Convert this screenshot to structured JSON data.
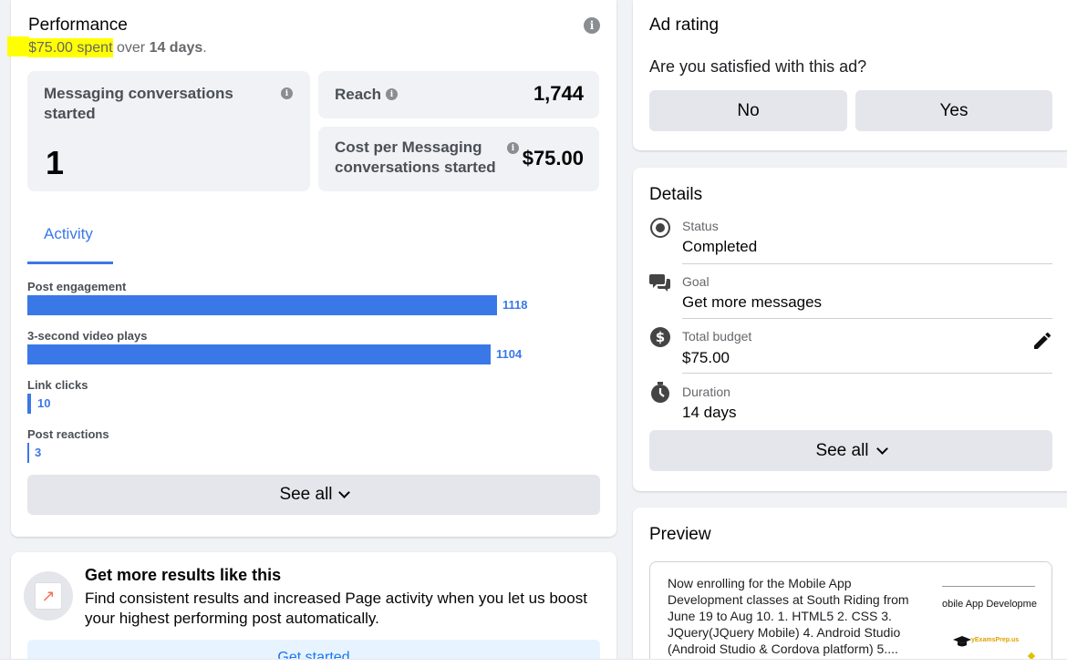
{
  "performance": {
    "title": "Performance",
    "spent_highlight": "$75.00 spent",
    "spent_over": "over",
    "spent_days": "14 days",
    "spent_period": ".",
    "metrics": {
      "messaging_label": "Messaging conversations started",
      "messaging_value": "1",
      "reach_label": "Reach",
      "reach_value": "1,744",
      "cost_label": "Cost per Messaging conversations started",
      "cost_value": "$75.00"
    },
    "tab_activity": "Activity",
    "activity": [
      {
        "label": "Post engagement",
        "value": "1118",
        "fraction": 1.0
      },
      {
        "label": "3-second video plays",
        "value": "1104",
        "fraction": 0.987
      },
      {
        "label": "Link clicks",
        "value": "10",
        "fraction": 0.009
      },
      {
        "label": "Post reactions",
        "value": "3",
        "fraction": 0.003
      }
    ],
    "see_all": "See all"
  },
  "promo": {
    "title": "Get more results like this",
    "body": "Find consistent results and increased Page activity when you let us boost your highest performing post automatically.",
    "cta": "Get started"
  },
  "ad_rating": {
    "title": "Ad rating",
    "question": "Are you satisfied with this ad?",
    "no": "No",
    "yes": "Yes"
  },
  "details": {
    "title": "Details",
    "status_label": "Status",
    "status_value": "Completed",
    "goal_label": "Goal",
    "goal_value": "Get more messages",
    "budget_label": "Total budget",
    "budget_value": "$75.00",
    "duration_label": "Duration",
    "duration_value": "14 days",
    "see_all": "See all"
  },
  "preview": {
    "title": "Preview",
    "text": "Now enrolling for the Mobile App Development classes at South Riding from June 19 to Aug 10. 1. HTML5 2. CSS 3. JQuery(JQuery Mobile) 4. Android Studio (Android Studio & Cordova platform) 5....",
    "thumb_title": "obile App Developme",
    "thumb_brand": "yExamsPrep.us"
  },
  "colors": {
    "accent": "#3a78e7",
    "highlight": "#ffff00",
    "background": "#f0f2f5"
  }
}
